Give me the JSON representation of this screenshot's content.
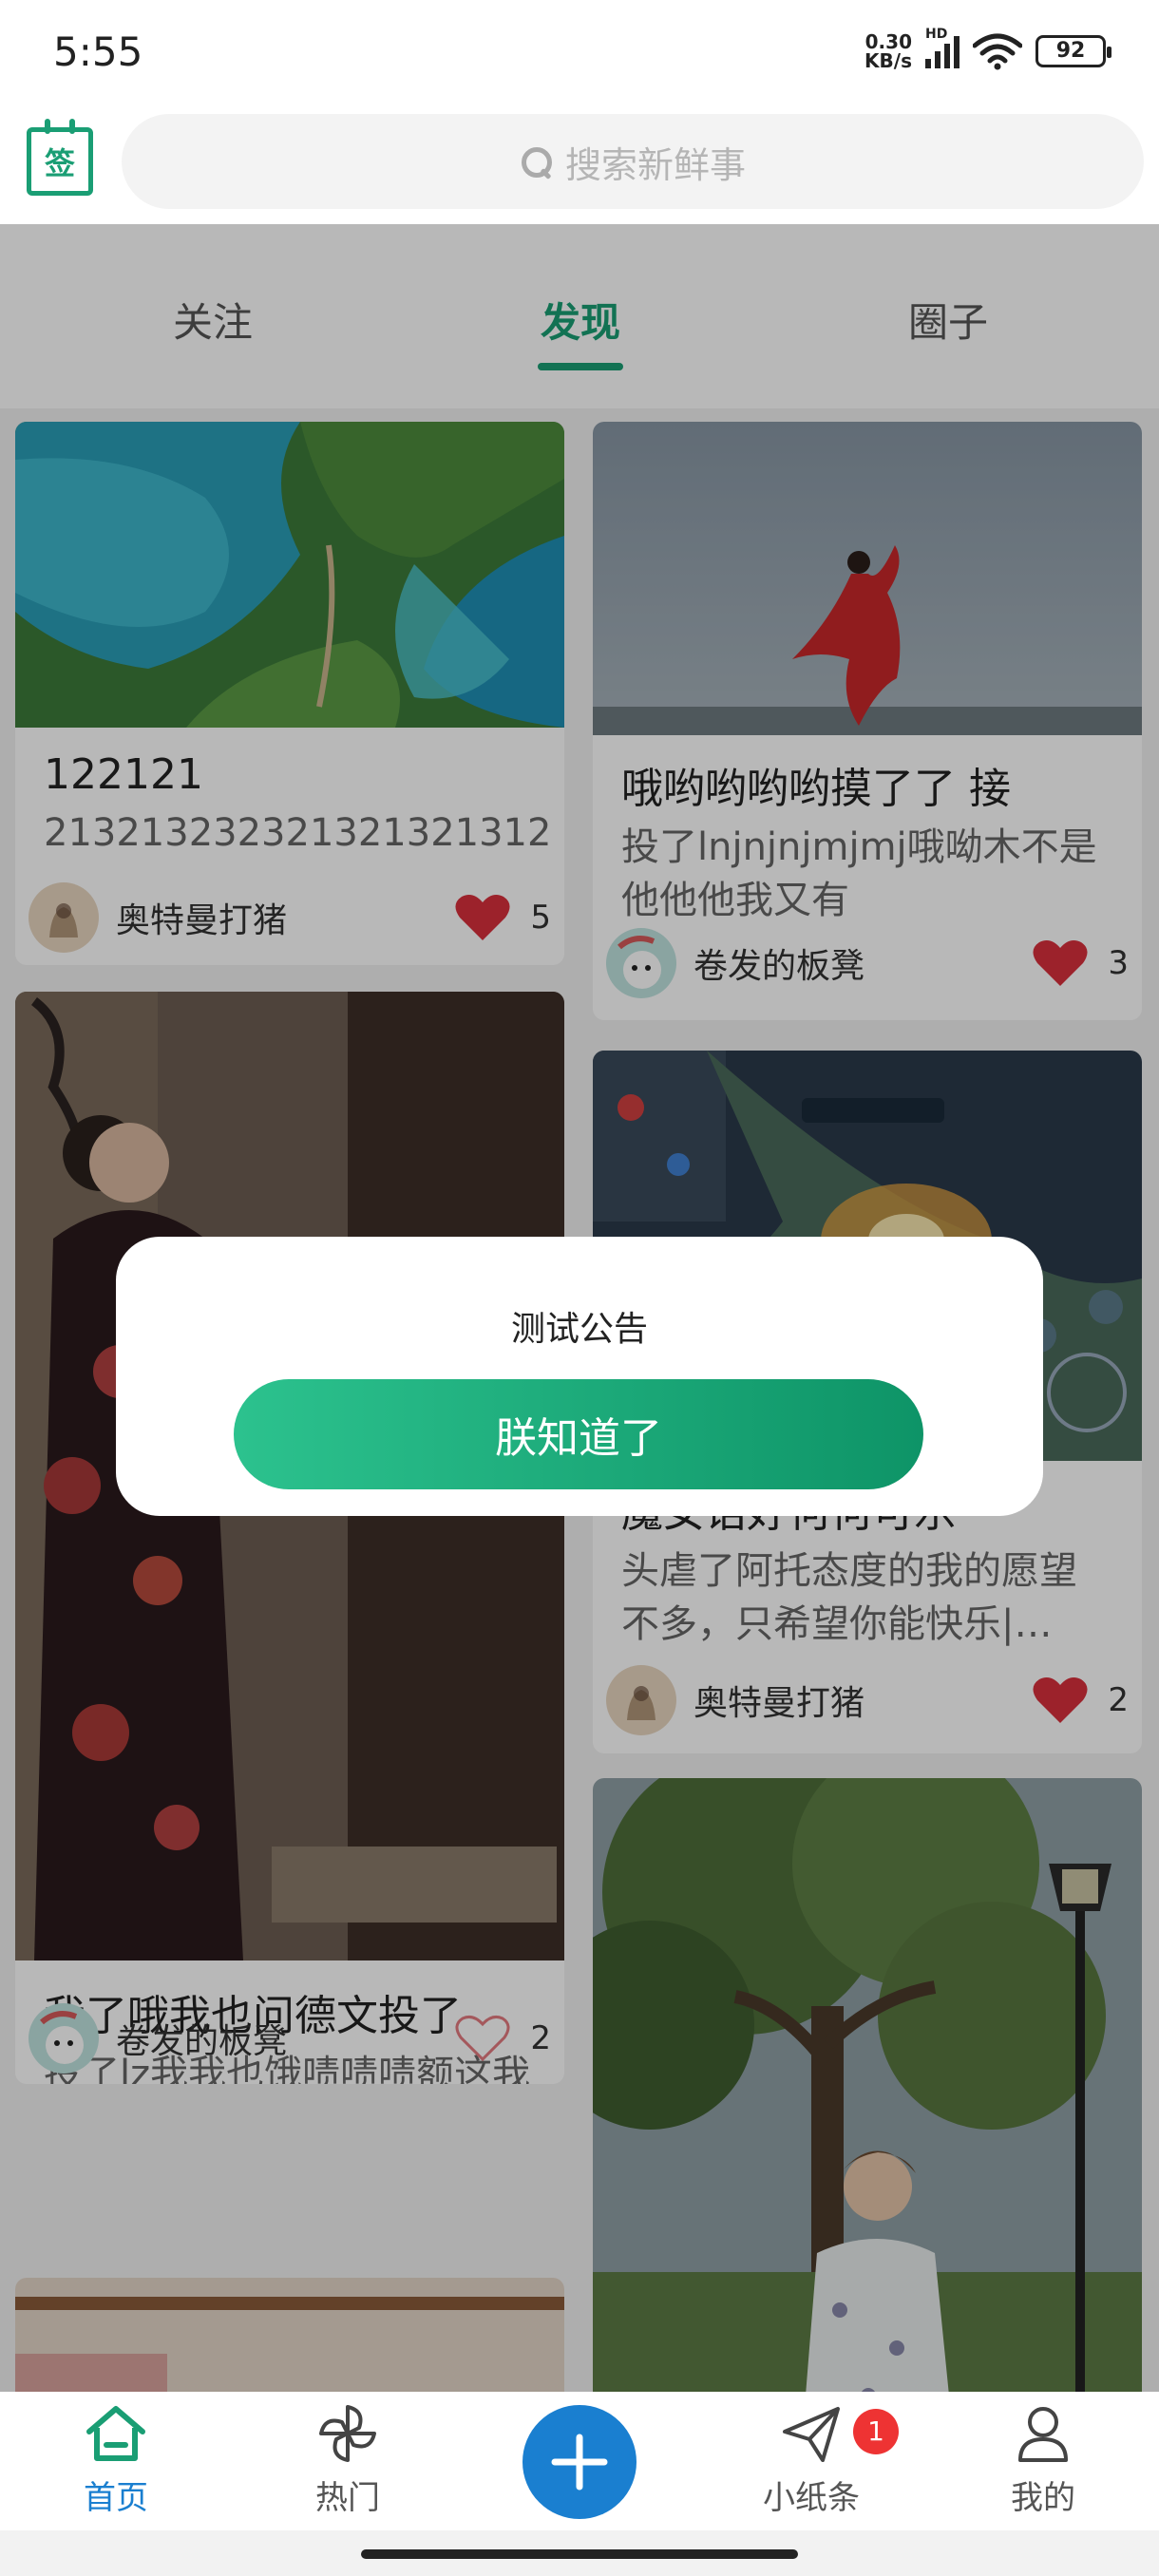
{
  "status_bar": {
    "time": "5:55",
    "net_speed": "0.30",
    "net_unit": "KB/s",
    "net_type": "HD",
    "battery": "92"
  },
  "header": {
    "sign_icon_char": "签",
    "search_placeholder": "搜索新鲜事"
  },
  "tabs": [
    {
      "label": "关注"
    },
    {
      "label": "发现"
    },
    {
      "label": "圈子"
    }
  ],
  "active_tab": "发现",
  "feed": {
    "left": [
      {
        "title": "122121",
        "desc": "2132132323213213213​12",
        "author": "奥特曼打猪",
        "likes": "5",
        "liked": true
      },
      {
        "title": "我了哦我也问德文投了",
        "desc": "投了lz我我也饿啧啧啧额这我也咋啦套路咯我我我…",
        "author": "卷发的板凳",
        "likes": "2",
        "liked": false
      }
    ],
    "right": [
      {
        "title": "哦哟哟哟哟摸了了 接",
        "desc": "投了lnjnjnjmjmj哦呦木不是他他他我又有",
        "author": "卷发的板凳",
        "likes": "3",
        "liked": true
      },
      {
        "title": "魔女话好何何可乐",
        "desc": "头虐了阿托态度的我的愿望不多，只希望你能快乐|…",
        "author": "奥特曼打猪",
        "likes": "2",
        "liked": true
      }
    ]
  },
  "dialog": {
    "message": "测试公告",
    "button": "朕知道了"
  },
  "tabbar": {
    "items": [
      {
        "label": "首页",
        "icon": "home-icon"
      },
      {
        "label": "热门",
        "icon": "pinwheel-icon"
      },
      {
        "label": "",
        "icon": "plus-icon"
      },
      {
        "label": "小纸条",
        "icon": "paper-plane-icon"
      },
      {
        "label": "我的",
        "icon": "user-icon"
      }
    ],
    "messages_badge": "1"
  },
  "colors": {
    "accent": "#1a9e74",
    "primary_blue": "#1a7fd0",
    "heart_red": "#d9303c",
    "badge_red": "#e33333"
  }
}
